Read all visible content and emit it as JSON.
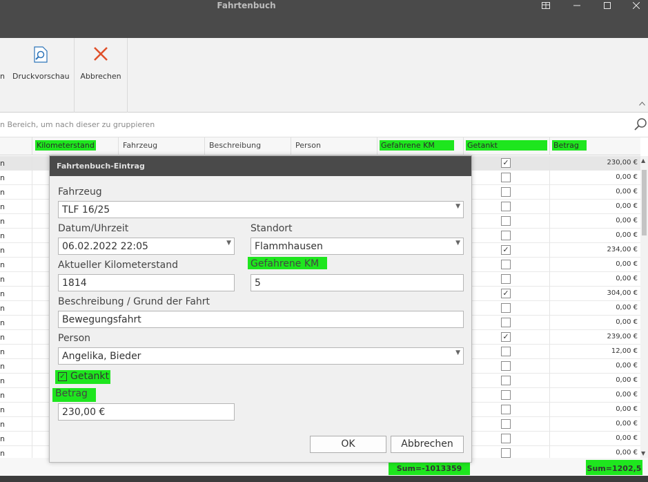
{
  "window": {
    "title": "Fahrtenbuch"
  },
  "ribbon": {
    "partial_label": "n",
    "print_preview_label": "Druckvorschau",
    "cancel_label": "Abbrechen"
  },
  "group_panel": {
    "hint": "n Bereich, um nach dieser zu gruppieren"
  },
  "columns": [
    "Kilometerstand",
    "Fahrzeug",
    "Beschreibung",
    "Person",
    "Gefahrene KM",
    "Getankt",
    "Betrag"
  ],
  "rows": [
    {
      "lead": "n",
      "checked": true,
      "amount": "230,00 €"
    },
    {
      "lead": "n",
      "checked": false,
      "amount": "0,00 €"
    },
    {
      "lead": "n",
      "checked": false,
      "amount": "0,00 €"
    },
    {
      "lead": "n",
      "checked": false,
      "amount": "0,00 €"
    },
    {
      "lead": "n",
      "checked": false,
      "amount": "0,00 €"
    },
    {
      "lead": "n",
      "checked": false,
      "amount": "0,00 €"
    },
    {
      "lead": "n",
      "checked": true,
      "amount": "234,00 €"
    },
    {
      "lead": "n",
      "checked": false,
      "amount": "0,00 €"
    },
    {
      "lead": "n",
      "checked": false,
      "amount": "0,00 €"
    },
    {
      "lead": "n",
      "checked": true,
      "amount": "304,00 €"
    },
    {
      "lead": "n",
      "checked": false,
      "amount": "0,00 €"
    },
    {
      "lead": "n",
      "checked": false,
      "amount": "0,00 €"
    },
    {
      "lead": "n",
      "checked": true,
      "amount": "239,00 €"
    },
    {
      "lead": "n",
      "checked": false,
      "amount": "12,00 €"
    },
    {
      "lead": "n",
      "checked": false,
      "amount": "0,00 €"
    },
    {
      "lead": "n",
      "checked": false,
      "amount": "0,00 €"
    },
    {
      "lead": "n",
      "checked": false,
      "amount": "0,00 €"
    },
    {
      "lead": "n",
      "checked": false,
      "amount": "0,00 €"
    },
    {
      "lead": "n",
      "checked": false,
      "amount": "0,00 €"
    },
    {
      "lead": "n",
      "checked": false,
      "amount": "0,00 €"
    },
    {
      "lead": "n",
      "checked": false,
      "amount": "0,00 €"
    }
  ],
  "footer": {
    "sum_km": "Sum=-1013359",
    "sum_amount": "Sum=1202,5"
  },
  "dialog": {
    "title": "Fahrtenbuch-Eintrag",
    "vehicle_label": "Fahrzeug",
    "vehicle_value": "TLF 16/25",
    "datetime_label": "Datum/Uhrzeit",
    "datetime_value": "06.02.2022 22:05",
    "location_label": "Standort",
    "location_value": "Flammhausen",
    "odometer_label": "Aktueller Kilometerstand",
    "odometer_value": "1814",
    "km_label": "Gefahrene KM",
    "km_value": "5",
    "description_label": "Beschreibung / Grund der Fahrt",
    "description_value": "Bewegungsfahrt",
    "person_label": "Person",
    "person_value": "Angelika, Bieder",
    "refuel_label": "Getankt",
    "refuel_checked": true,
    "amount_label": "Betrag",
    "amount_value": "230,00 €",
    "ok_label": "OK",
    "cancel_label": "Abbrechen"
  },
  "colors": {
    "highlight": "#1ee61e",
    "titlebar": "#4a4a4a",
    "cancel_icon": "#e0502a"
  },
  "icons": [
    "print-preview-icon",
    "cancel-x-icon",
    "search-icon",
    "restore-icon",
    "minimize-icon",
    "maximize-icon",
    "close-icon"
  ]
}
